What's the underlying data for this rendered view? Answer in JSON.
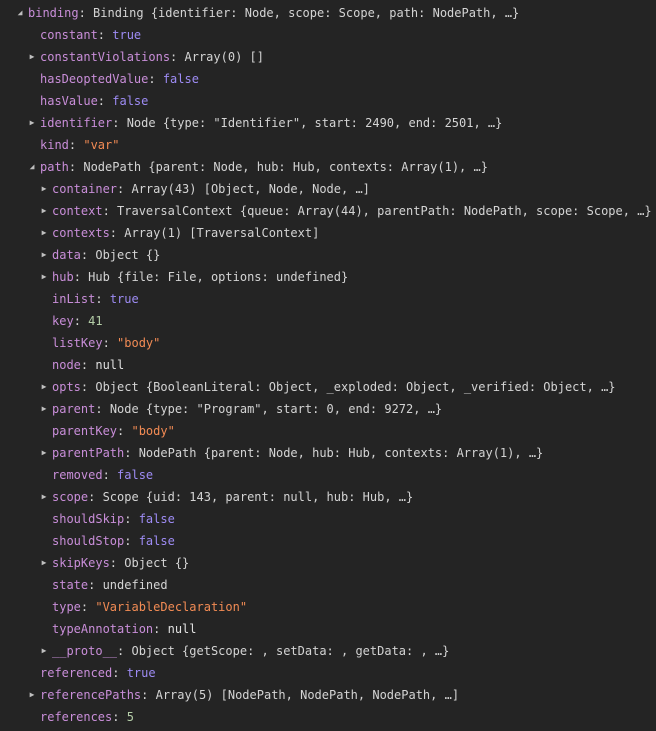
{
  "colors": {
    "background": "#242424",
    "key": "#c98ed9",
    "bool": "#9b90f0",
    "string": "#f28b54",
    "number": "#b5cea8",
    "text": "#d4d4d4"
  },
  "rows": [
    {
      "d": 0,
      "tw": "expanded",
      "key": "binding",
      "val": "Binding {identifier: Node, scope: Scope, path: NodePath, …}",
      "vt": "plain"
    },
    {
      "d": 1,
      "tw": "none",
      "key": "constant",
      "val": "true",
      "vt": "bool"
    },
    {
      "d": 1,
      "tw": "collapsed",
      "key": "constantViolations",
      "val": "Array(0) []",
      "vt": "plain"
    },
    {
      "d": 1,
      "tw": "none",
      "key": "hasDeoptedValue",
      "val": "false",
      "vt": "bool"
    },
    {
      "d": 1,
      "tw": "none",
      "key": "hasValue",
      "val": "false",
      "vt": "bool"
    },
    {
      "d": 1,
      "tw": "collapsed",
      "key": "identifier",
      "val": "Node {type: \"Identifier\", start: 2490, end: 2501, …}",
      "vt": "plain"
    },
    {
      "d": 1,
      "tw": "none",
      "key": "kind",
      "val": "\"var\"",
      "vt": "str"
    },
    {
      "d": 1,
      "tw": "expanded",
      "key": "path",
      "val": "NodePath {parent: Node, hub: Hub, contexts: Array(1), …}",
      "vt": "plain"
    },
    {
      "d": 2,
      "tw": "collapsed",
      "key": "container",
      "val": "Array(43) [Object, Node, Node, …]",
      "vt": "plain"
    },
    {
      "d": 2,
      "tw": "collapsed",
      "key": "context",
      "val": "TraversalContext {queue: Array(44), parentPath: NodePath, scope: Scope, …}",
      "vt": "plain"
    },
    {
      "d": 2,
      "tw": "collapsed",
      "key": "contexts",
      "val": "Array(1) [TraversalContext]",
      "vt": "plain"
    },
    {
      "d": 2,
      "tw": "collapsed",
      "key": "data",
      "val": "Object {}",
      "vt": "plain"
    },
    {
      "d": 2,
      "tw": "collapsed",
      "key": "hub",
      "val": "Hub {file: File, options: undefined}",
      "vt": "plain"
    },
    {
      "d": 2,
      "tw": "none",
      "key": "inList",
      "val": "true",
      "vt": "bool"
    },
    {
      "d": 2,
      "tw": "none",
      "key": "key",
      "val": "41",
      "vt": "num"
    },
    {
      "d": 2,
      "tw": "none",
      "key": "listKey",
      "val": "\"body\"",
      "vt": "str"
    },
    {
      "d": 2,
      "tw": "none",
      "key": "node",
      "val": "null",
      "vt": "null"
    },
    {
      "d": 2,
      "tw": "collapsed",
      "key": "opts",
      "val": "Object {BooleanLiteral: Object, _exploded: Object, _verified: Object, …}",
      "vt": "plain"
    },
    {
      "d": 2,
      "tw": "collapsed",
      "key": "parent",
      "val": "Node {type: \"Program\", start: 0, end: 9272, …}",
      "vt": "plain"
    },
    {
      "d": 2,
      "tw": "none",
      "key": "parentKey",
      "val": "\"body\"",
      "vt": "str"
    },
    {
      "d": 2,
      "tw": "collapsed",
      "key": "parentPath",
      "val": "NodePath {parent: Node, hub: Hub, contexts: Array(1), …}",
      "vt": "plain"
    },
    {
      "d": 2,
      "tw": "none",
      "key": "removed",
      "val": "false",
      "vt": "bool"
    },
    {
      "d": 2,
      "tw": "collapsed",
      "key": "scope",
      "val": "Scope {uid: 143, parent: null, hub: Hub, …}",
      "vt": "plain"
    },
    {
      "d": 2,
      "tw": "none",
      "key": "shouldSkip",
      "val": "false",
      "vt": "bool"
    },
    {
      "d": 2,
      "tw": "none",
      "key": "shouldStop",
      "val": "false",
      "vt": "bool"
    },
    {
      "d": 2,
      "tw": "collapsed",
      "key": "skipKeys",
      "val": "Object {}",
      "vt": "plain"
    },
    {
      "d": 2,
      "tw": "none",
      "key": "state",
      "val": "undefined",
      "vt": "plain"
    },
    {
      "d": 2,
      "tw": "none",
      "key": "type",
      "val": "\"VariableDeclaration\"",
      "vt": "str"
    },
    {
      "d": 2,
      "tw": "none",
      "key": "typeAnnotation",
      "val": "null",
      "vt": "null"
    },
    {
      "d": 2,
      "tw": "collapsed",
      "key": "__proto__",
      "val": "Object {getScope: , setData: , getData: , …}",
      "vt": "plain"
    },
    {
      "d": 1,
      "tw": "none",
      "key": "referenced",
      "val": "true",
      "vt": "bool"
    },
    {
      "d": 1,
      "tw": "collapsed",
      "key": "referencePaths",
      "val": "Array(5) [NodePath, NodePath, NodePath, …]",
      "vt": "plain"
    },
    {
      "d": 1,
      "tw": "none",
      "key": "references",
      "val": "5",
      "vt": "num"
    }
  ]
}
